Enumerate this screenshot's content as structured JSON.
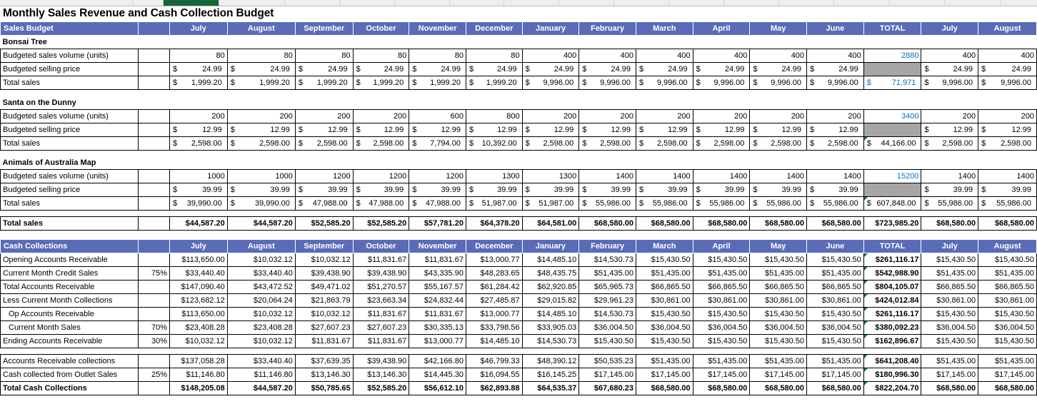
{
  "title": "Monthly Sales Revenue and Cash Collection Budget",
  "colstrip": {
    "selected_index": 2
  },
  "columns": {
    "sales_header": "Sales Budget",
    "cash_header": "Cash Collections",
    "months": [
      "July",
      "August",
      "September",
      "October",
      "November",
      "December",
      "January",
      "February",
      "March",
      "April",
      "May",
      "June"
    ],
    "total": "TOTAL",
    "extra": [
      "July",
      "August"
    ]
  },
  "colors": {
    "header_band": "#5a6cb8",
    "header_text": "#ffffff",
    "blue_text": "#0070c0",
    "gray_fill": "#a6a6a6",
    "error_triangle": "#1a7a3c"
  },
  "products": [
    {
      "name": "Bonsai Tree",
      "rows": [
        {
          "label": "Budgeted sales volume (units)",
          "style": "plain",
          "values": [
            "80",
            "80",
            "80",
            "80",
            "80",
            "80",
            "400",
            "400",
            "400",
            "400",
            "400",
            "400"
          ],
          "total": "2880",
          "total_style": "blue",
          "extra": [
            "400",
            "400"
          ]
        },
        {
          "label": "Budgeted selling price",
          "style": "currency",
          "values": [
            "24.99",
            "24.99",
            "24.99",
            "24.99",
            "24.99",
            "24.99",
            "24.99",
            "24.99",
            "24.99",
            "24.99",
            "24.99",
            "24.99"
          ],
          "total": "",
          "total_style": "gray",
          "extra": [
            "24.99",
            "24.99"
          ]
        },
        {
          "label": "Total sales",
          "style": "currency",
          "values": [
            "1,999.20",
            "1,999.20",
            "1,999.20",
            "1,999.20",
            "1,999.20",
            "1,999.20",
            "9,996.00",
            "9,996.00",
            "9,996.00",
            "9,996.00",
            "9,996.00",
            "9,996.00"
          ],
          "total": "71,971",
          "total_style": "blue-currency",
          "extra": [
            "9,996.00",
            "9,996.00"
          ]
        }
      ]
    },
    {
      "name": "Santa on the Dunny",
      "rows": [
        {
          "label": "Budgeted sales volume (units)",
          "style": "plain",
          "values": [
            "200",
            "200",
            "200",
            "200",
            "600",
            "800",
            "200",
            "200",
            "200",
            "200",
            "200",
            "200"
          ],
          "total": "3400",
          "total_style": "blue",
          "extra": [
            "200",
            "200"
          ]
        },
        {
          "label": "Budgeted selling price",
          "style": "currency",
          "values": [
            "12.99",
            "12.99",
            "12.99",
            "12.99",
            "12.99",
            "12.99",
            "12.99",
            "12.99",
            "12.99",
            "12.99",
            "12.99",
            "12.99"
          ],
          "total": "",
          "total_style": "gray",
          "extra": [
            "12.99",
            "12.99"
          ]
        },
        {
          "label": "Total sales",
          "style": "currency",
          "values": [
            "2,598.00",
            "2,598.00",
            "2,598.00",
            "2,598.00",
            "7,794.00",
            "10,392.00",
            "2,598.00",
            "2,598.00",
            "2,598.00",
            "2,598.00",
            "2,598.00",
            "2,598.00"
          ],
          "total": "44,166.00",
          "total_style": "currency-err",
          "extra": [
            "2,598.00",
            "2,598.00"
          ]
        }
      ]
    },
    {
      "name": "Animals of Australia Map",
      "rows": [
        {
          "label": "Budgeted sales volume (units)",
          "style": "plain",
          "values": [
            "1000",
            "1000",
            "1200",
            "1200",
            "1200",
            "1300",
            "1300",
            "1400",
            "1400",
            "1400",
            "1400",
            "1400"
          ],
          "total": "15200",
          "total_style": "blue",
          "extra": [
            "1400",
            "1400"
          ]
        },
        {
          "label": "Budgeted selling price",
          "style": "currency",
          "values": [
            "39.99",
            "39.99",
            "39.99",
            "39.99",
            "39.99",
            "39.99",
            "39.99",
            "39.99",
            "39.99",
            "39.99",
            "39.99",
            "39.99"
          ],
          "total": "",
          "total_style": "gray",
          "extra": [
            "39.99",
            "39.99"
          ]
        },
        {
          "label": "Total sales",
          "style": "currency",
          "values": [
            "39,990.00",
            "39,990.00",
            "47,988.00",
            "47,988.00",
            "47,988.00",
            "51,987.00",
            "51,987.00",
            "55,986.00",
            "55,986.00",
            "55,986.00",
            "55,986.00",
            "55,986.00"
          ],
          "total": "607,848.00",
          "total_style": "currency-err",
          "extra": [
            "55,986.00",
            "55,986.00"
          ]
        }
      ]
    }
  ],
  "total_sales_row": {
    "label": "Total sales",
    "style": "currency",
    "bold": true,
    "values": [
      "44,587.20",
      "44,587.20",
      "52,585.20",
      "52,585.20",
      "57,781.20",
      "64,378.20",
      "64,581.00",
      "68,580.00",
      "68,580.00",
      "68,580.00",
      "68,580.00",
      "68,580.00"
    ],
    "total": "723,985.20",
    "extra": [
      "68,580.00",
      "68,580.00"
    ]
  },
  "cash_rows": [
    {
      "label": "Opening Accounts Receivable",
      "pct": "",
      "indent": false,
      "values": [
        "113,650.00",
        "10,032.12",
        "10,032.12",
        "11,831.67",
        "11,831.67",
        "13,000.77",
        "14,485.10",
        "14,530.73",
        "15,430.50",
        "15,430.50",
        "15,430.50",
        "15,430.50"
      ],
      "total": "261,116.17",
      "extra": [
        "15,430.50",
        "15,430.50"
      ]
    },
    {
      "label": "Current Month Credit Sales",
      "pct": "75%",
      "indent": false,
      "values": [
        "33,440.40",
        "33,440.40",
        "39,438.90",
        "39,438.90",
        "43,335.90",
        "48,283.65",
        "48,435.75",
        "51,435.00",
        "51,435.00",
        "51,435.00",
        "51,435.00",
        "51,435.00"
      ],
      "total": "542,988.90",
      "extra": [
        "51,435.00",
        "51,435.00"
      ]
    },
    {
      "label": "Total Accounts Receivable",
      "pct": "",
      "indent": false,
      "values": [
        "147,090.40",
        "43,472.52",
        "49,471.02",
        "51,270.57",
        "55,167.57",
        "61,284.42",
        "62,920.85",
        "65,965.73",
        "66,865.50",
        "66,865.50",
        "66,865.50",
        "66,865.50"
      ],
      "total": "804,105.07",
      "extra": [
        "66,865.50",
        "66,865.50"
      ]
    },
    {
      "label": "Less Current Month Collections",
      "pct": "",
      "indent": false,
      "values": [
        "123,682.12",
        "20,064.24",
        "21,863.79",
        "23,663.34",
        "24,832.44",
        "27,485.87",
        "29,015.82",
        "29,961.23",
        "30,861.00",
        "30,861.00",
        "30,861.00",
        "30,861.00"
      ],
      "total": "424,012.84",
      "extra": [
        "30,861.00",
        "30,861.00"
      ]
    },
    {
      "label": "Op Accounts Receivable",
      "pct": "",
      "indent": true,
      "values": [
        "113,650.00",
        "10,032.12",
        "10,032.12",
        "11,831.67",
        "11,831.67",
        "13,000.77",
        "14,485.10",
        "14,530.73",
        "15,430.50",
        "15,430.50",
        "15,430.50",
        "15,430.50"
      ],
      "total": "261,116.17",
      "extra": [
        "15,430.50",
        "15,430.50"
      ]
    },
    {
      "label": "Current Month Sales",
      "pct": "70%",
      "indent": true,
      "values": [
        "23,408.28",
        "23,408.28",
        "27,607.23",
        "27,607.23",
        "30,335.13",
        "33,798.56",
        "33,905.03",
        "36,004.50",
        "36,004.50",
        "36,004.50",
        "36,004.50",
        "36,004.50"
      ],
      "total": "380,092.23",
      "extra": [
        "36,004.50",
        "36,004.50"
      ]
    },
    {
      "label": "Ending Accounts Receivable",
      "pct": "30%",
      "indent": false,
      "values": [
        "10,032.12",
        "10,032.12",
        "11,831.67",
        "11,831.67",
        "13,000.77",
        "14,485.10",
        "14,530.73",
        "15,430.50",
        "15,430.50",
        "15,430.50",
        "15,430.50",
        "15,430.50"
      ],
      "total": "162,896.67",
      "extra": [
        "15,430.50",
        "15,430.50"
      ]
    }
  ],
  "collection_rows": [
    {
      "label": "Accounts Receivable collections",
      "pct": "",
      "bold": false,
      "values": [
        "137,058.28",
        "33,440.40",
        "37,639.35",
        "39,438.90",
        "42,166.80",
        "46,799.33",
        "48,390.12",
        "50,535.23",
        "51,435.00",
        "51,435.00",
        "51,435.00",
        "51,435.00"
      ],
      "total": "641,208.40",
      "extra": [
        "51,435.00",
        "51,435.00"
      ]
    },
    {
      "label": "Cash collected from Outlet Sales",
      "pct": "25%",
      "bold": false,
      "values": [
        "11,146.80",
        "11,146.80",
        "13,146.30",
        "13,146.30",
        "14,445.30",
        "16,094.55",
        "16,145.25",
        "17,145.00",
        "17,145.00",
        "17,145.00",
        "17,145.00",
        "17,145.00"
      ],
      "total": "180,996.30",
      "extra": [
        "17,145.00",
        "17,145.00"
      ]
    },
    {
      "label": "Total Cash Collections",
      "pct": "",
      "bold": true,
      "values": [
        "148,205.08",
        "44,587.20",
        "50,785.65",
        "52,585.20",
        "56,612.10",
        "62,893.88",
        "64,535.37",
        "67,680.23",
        "68,580.00",
        "68,580.00",
        "68,580.00",
        "68,580.00"
      ],
      "total": "822,204.70",
      "extra": [
        "68,580.00",
        "68,580.00"
      ]
    }
  ]
}
